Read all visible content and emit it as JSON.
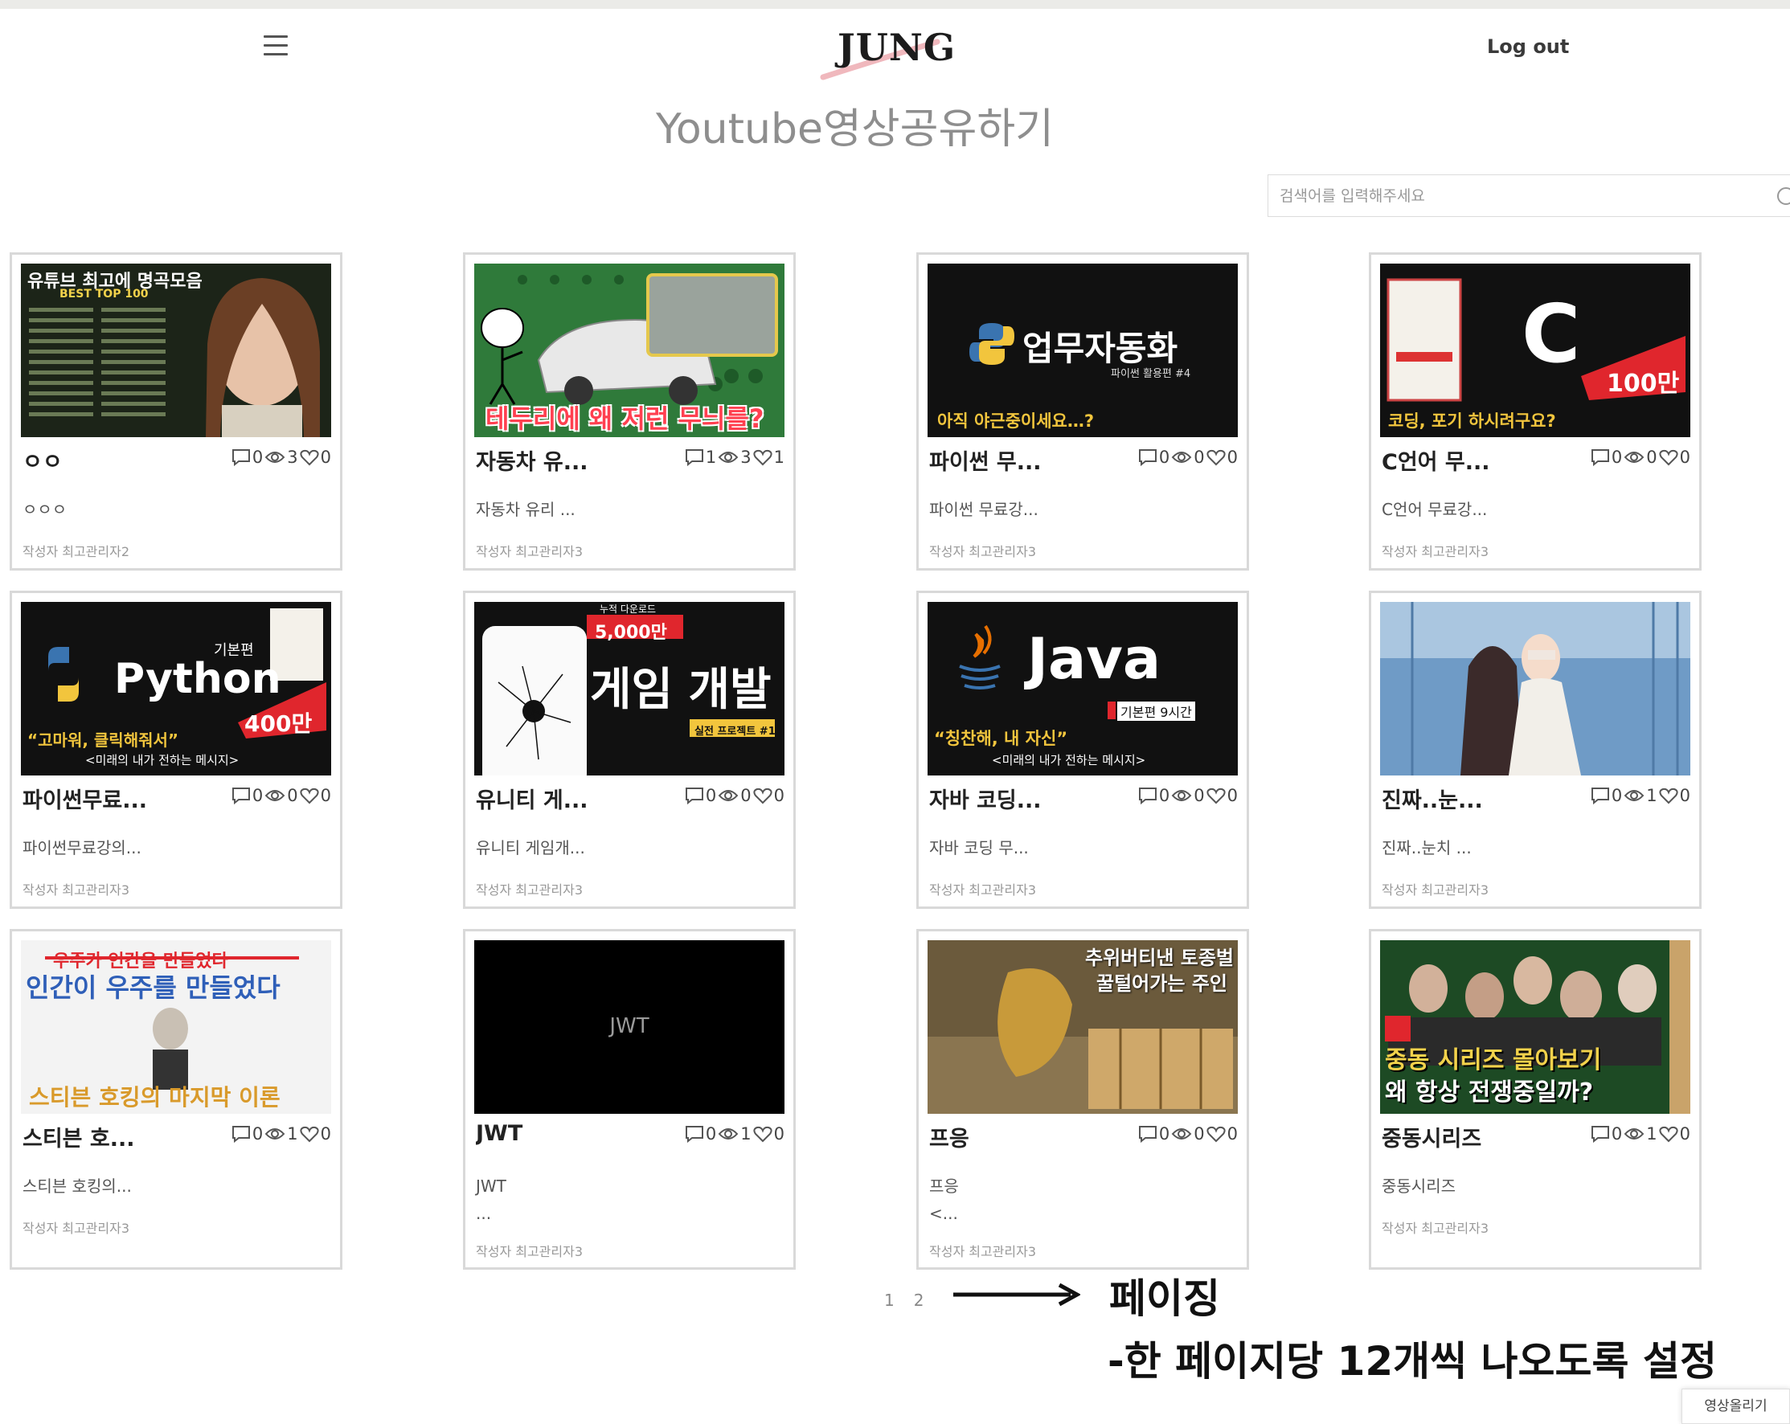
{
  "header": {
    "logo_text": "JUNG",
    "logout_label": "Log out"
  },
  "page_title": "Youtube영상공유하기",
  "search": {
    "placeholder": "검색어를 입력해주세요"
  },
  "icons": {
    "menu": "hamburger-icon",
    "search": "search-icon",
    "comment": "comment-icon",
    "views": "eye-icon",
    "likes": "heart-icon"
  },
  "colors": {
    "accent_red": "#e0262d",
    "card_border": "#d9d9d9"
  },
  "cards": [
    {
      "title": "ㅇㅇ",
      "comments": "0",
      "views": "3",
      "likes": "0",
      "desc": "ㅇㅇㅇ",
      "author": "작성자 최고관리자2",
      "thumb": {
        "bg": "#1a1f16",
        "line1": "유튜브 최고에 명곡모음",
        "line2": "BEST TOP 100"
      }
    },
    {
      "title": "자동차 유...",
      "comments": "1",
      "views": "3",
      "likes": "1",
      "desc": "자동차 유리 ...",
      "author": "작성자 최고관리자3",
      "thumb": {
        "bg": "#2f7a3a",
        "caption": "테두리에 왜 저런 무늬를?"
      }
    },
    {
      "title": "파이썬 무...",
      "comments": "0",
      "views": "0",
      "likes": "0",
      "desc": "파이썬 무료강...",
      "author": "작성자 최고관리자3",
      "thumb": {
        "bg": "#111111",
        "main": "업무자동화",
        "sub": "파이썬 활용편 #4",
        "caption": "아직 야근중이세요…?"
      }
    },
    {
      "title": "C언어 무...",
      "comments": "0",
      "views": "0",
      "likes": "0",
      "desc": "C언어 무료강...",
      "author": "작성자 최고관리자3",
      "thumb": {
        "bg": "#111111",
        "main": "C",
        "badge": "100만",
        "caption": "코딩, 포기 하시려구요?"
      }
    },
    {
      "title": "파이썬무료...",
      "comments": "0",
      "views": "0",
      "likes": "0",
      "desc": "파이썬무료강의...",
      "author": "작성자 최고관리자3",
      "thumb": {
        "bg": "#111111",
        "main": "Python",
        "tag": "기본편",
        "badge": "400만",
        "caption": "“고마워, 클릭해줘서”",
        "sub": "<미래의 내가 전하는 메시지>"
      }
    },
    {
      "title": "유니티 게...",
      "comments": "0",
      "views": "0",
      "likes": "0",
      "desc": "유니티 게임개...",
      "author": "작성자 최고관리자3",
      "thumb": {
        "bg": "#111111",
        "main": "게임 개발",
        "badge": "5,000만",
        "tag": "누적 다운로드",
        "sub": "실전 프로젝트 #1"
      }
    },
    {
      "title": "자바 코딩...",
      "comments": "0",
      "views": "0",
      "likes": "0",
      "desc": "자바 코딩 무...",
      "author": "작성자 최고관리자3",
      "thumb": {
        "bg": "#111111",
        "main": "Java",
        "tag": "기본편 9시간",
        "caption": "“칭찬해, 내 자신”",
        "sub": "<미래의 내가 전하는 메시지>"
      }
    },
    {
      "title": "진짜..눈...",
      "comments": "0",
      "views": "1",
      "likes": "0",
      "desc": "진짜..눈치 ...",
      "author": "작성자 최고관리자3",
      "thumb": {
        "bg": "#6f9bc6"
      }
    },
    {
      "title": "스티븐 호...",
      "comments": "0",
      "views": "1",
      "likes": "0",
      "desc": "스티븐 호킹의...",
      "author": "작성자 최고관리자3",
      "thumb": {
        "bg": "#f3f3f3",
        "line1": "우주가 인간을 만들었다",
        "line2": "인간이 우주를 만들었다",
        "caption": "스티븐 호킹의 마지막 이론"
      }
    },
    {
      "title": "JWT",
      "comments": "0",
      "views": "1",
      "likes": "0",
      "desc": "JWT\n...",
      "author": "작성자 최고관리자3",
      "thumb": {
        "bg": "#000000",
        "main": "JWT"
      }
    },
    {
      "title": "프응",
      "comments": "0",
      "views": "0",
      "likes": "0",
      "desc": "프응\n<...",
      "author": "작성자 최고관리자3",
      "thumb": {
        "bg": "#6b5a3c",
        "line1": "추위버티낸 토종벌",
        "line2": "꿀털어가는 주인"
      }
    },
    {
      "title": "중동시리즈",
      "comments": "0",
      "views": "1",
      "likes": "0",
      "desc": "중동시리즈",
      "author": "작성자 최고관리자3",
      "thumb": {
        "bg": "#1d4a24",
        "line1": "중동 시리즈 몰아보기",
        "line2": "왜 항상 전쟁중일까?"
      }
    }
  ],
  "pagination": {
    "pages": [
      "1",
      "2"
    ]
  },
  "annotation": {
    "title": "페이징",
    "detail": "-한 페이지당 12개씩 나오도록 설정"
  },
  "upload_label": "영상올리기"
}
